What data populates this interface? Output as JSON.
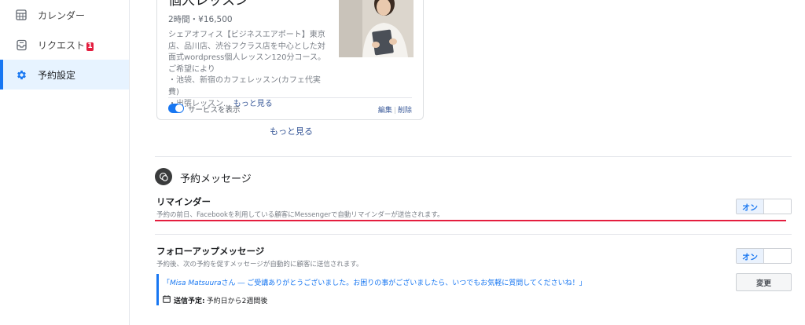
{
  "sidebar": {
    "items": [
      {
        "label": "カレンダー",
        "icon": "calendar-icon"
      },
      {
        "label": "リクエスト",
        "icon": "inbox-icon",
        "badge": "1"
      },
      {
        "label": "予約設定",
        "icon": "gear-icon",
        "active": true
      }
    ]
  },
  "service_card": {
    "title": "個人レッスン",
    "subtitle": "2時間・¥16,500",
    "description": "シェアオフィス【ビジネスエアポート】東京店、品川店、渋谷フクラス店を中心とした対面式wordpress個人レッスン120分コース。",
    "desc_line2": "ご希望により",
    "desc_line3": "・池袋、新宿のカフェレッスン(カフェ代実費)",
    "desc_line4": "・出張レッスン...",
    "desc_more": "もっと見る",
    "toggle_label": "サービスを表示",
    "edit_label": "編集",
    "separator": "|",
    "delete_label": "削除"
  },
  "more_link": "もっと見る",
  "messages_section": {
    "title": "予約メッセージ",
    "reminder": {
      "title": "リマインダー",
      "description": "予約の前日、Facebookを利用している顧客にMessengerで自動リマインダーが送信されます。",
      "on_label": "オン"
    },
    "followup": {
      "title": "フォローアップメッセージ",
      "description": "予約後、次の予約を促すメッセージが自動的に顧客に送信されます。",
      "on_label": "オン",
      "quote_open": "「",
      "quote_name": "Misa Matsuura",
      "quote_body": "さん ― ご受講ありがとうございました。お困りの事がございましたら、いつでもお気軽に質問してくださいね！」",
      "schedule_key": "送信予定:",
      "schedule_value": "予約日から2週間後",
      "change_button": "変更"
    }
  },
  "colors": {
    "accent": "#1877f2",
    "highlight_line": "#e41e3f",
    "active_bg": "#e7f3ff"
  }
}
